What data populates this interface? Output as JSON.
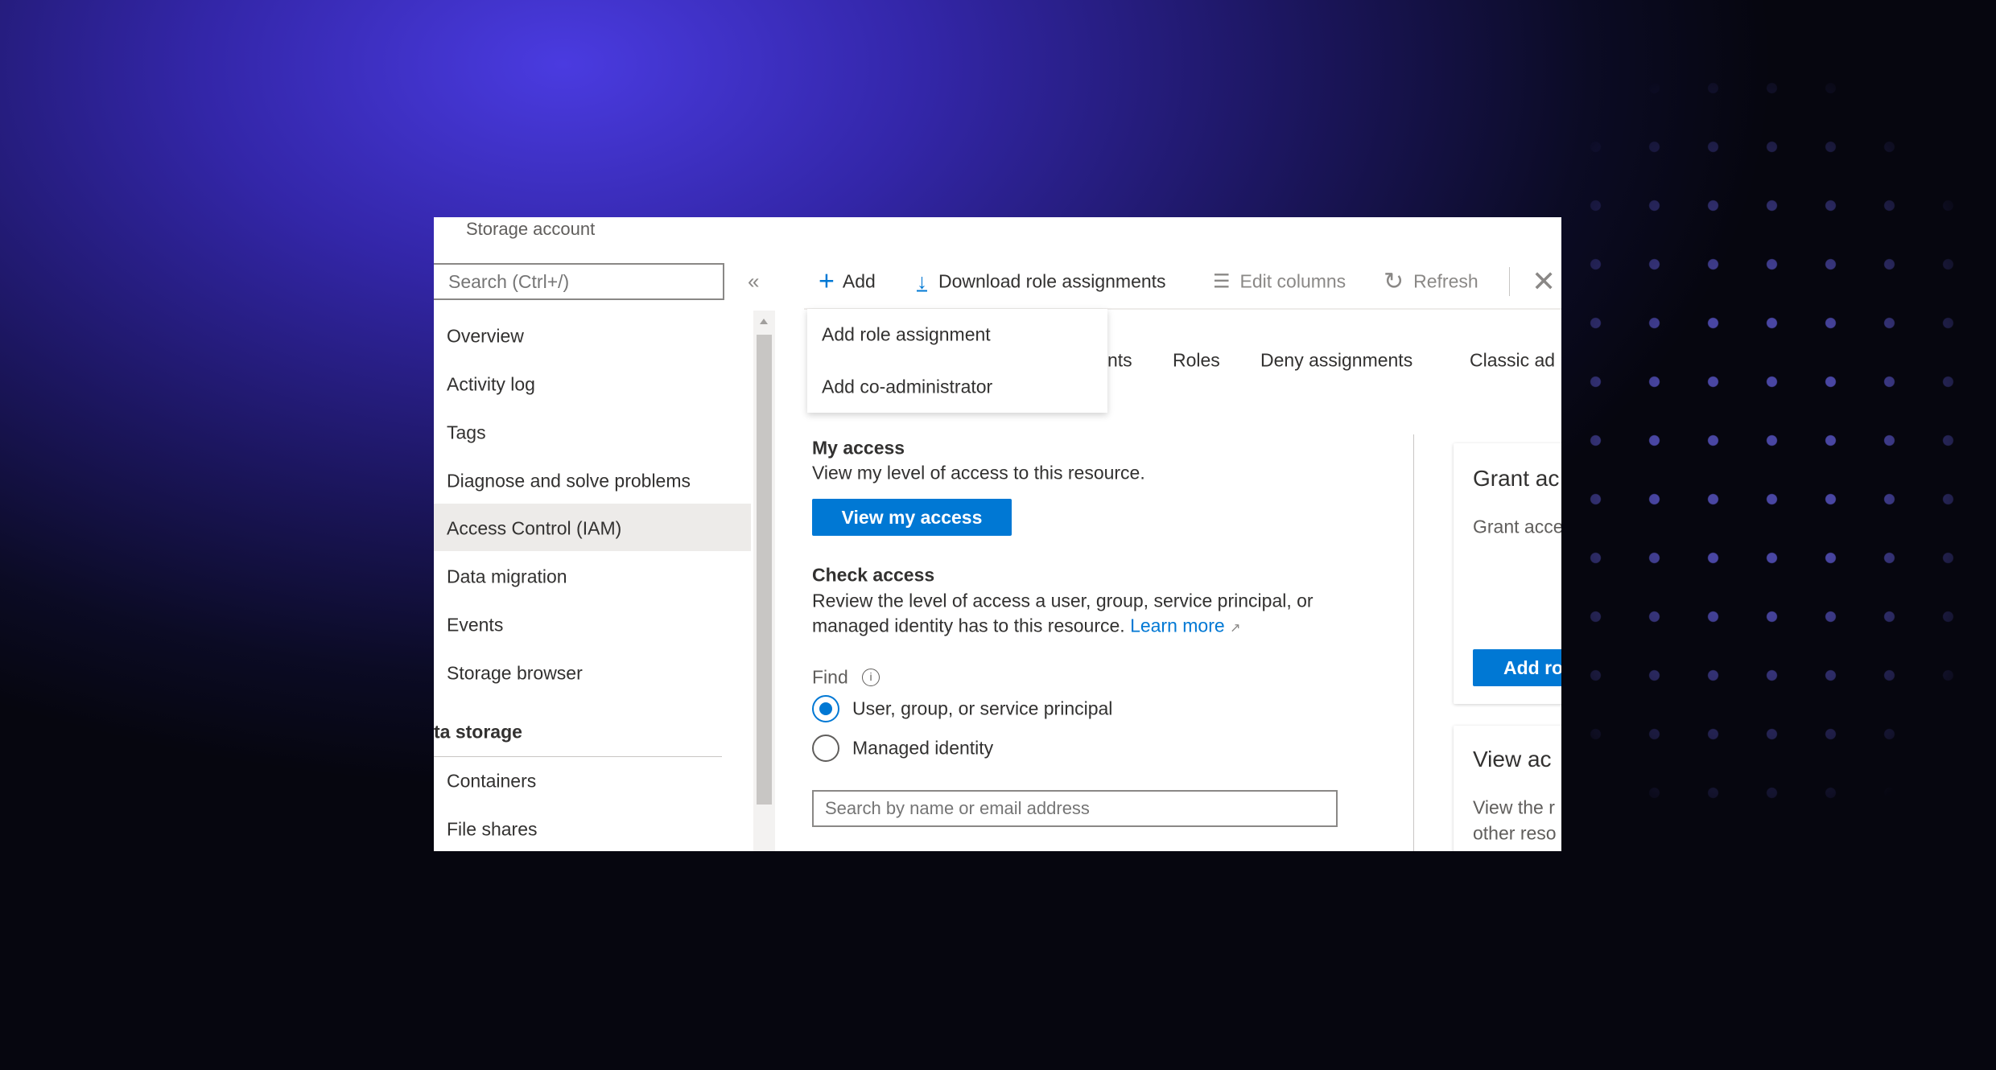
{
  "header": {
    "title": "Storage account"
  },
  "sidebar": {
    "search_placeholder": "Search (Ctrl+/)",
    "collapse_glyph": "«",
    "items": [
      {
        "label": "Overview"
      },
      {
        "label": "Activity log"
      },
      {
        "label": "Tags"
      },
      {
        "label": "Diagnose and solve problems"
      },
      {
        "label": "Access Control (IAM)",
        "selected": true
      },
      {
        "label": "Data migration"
      },
      {
        "label": "Events"
      },
      {
        "label": "Storage browser"
      }
    ],
    "section": "ta storage",
    "section_items": [
      {
        "label": "Containers"
      },
      {
        "label": "File shares"
      }
    ]
  },
  "toolbar": {
    "add": "Add",
    "download": "Download role assignments",
    "edit_columns": "Edit columns",
    "refresh": "Refresh"
  },
  "add_menu": {
    "items": [
      "Add role assignment",
      "Add co-administrator"
    ]
  },
  "tabs": [
    "nts",
    "Roles",
    "Deny assignments",
    "Classic ad"
  ],
  "my_access": {
    "title": "My access",
    "description": "View my level of access to this resource.",
    "button": "View my access"
  },
  "check_access": {
    "title": "Check access",
    "description_line1": "Review the level of access a user, group, service principal, or",
    "description_line2": "managed identity has to this resource.",
    "learn_more": "Learn more",
    "find_label": "Find",
    "options": [
      {
        "label": "User, group, or service principal",
        "selected": true
      },
      {
        "label": "Managed identity",
        "selected": false
      }
    ],
    "search_placeholder": "Search by name or email address"
  },
  "cards": {
    "grant": {
      "title": "Grant ac",
      "text": "Grant acce",
      "button": "Add ro"
    },
    "view": {
      "title": "View ac",
      "line1": "View the r",
      "line2": "other reso"
    }
  },
  "colors": {
    "accent": "#0078d4",
    "selected_bg": "#edebe9"
  }
}
